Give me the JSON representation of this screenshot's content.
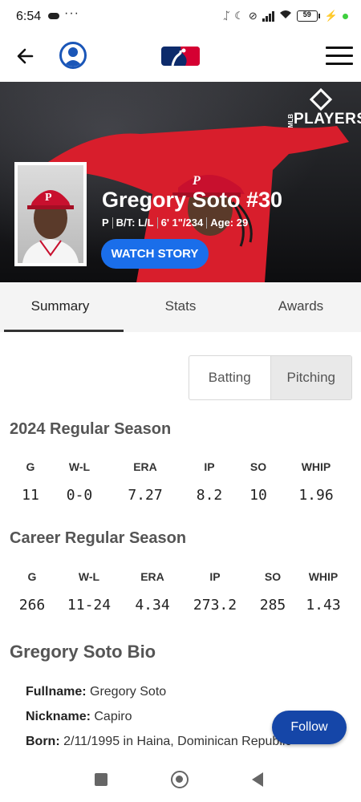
{
  "status_bar": {
    "time": "6:54",
    "battery": "59"
  },
  "header": {
    "logo": "mlb-logo",
    "menu_icon": "hamburger-menu-icon",
    "back_icon": "back-arrow-icon",
    "profile_icon": "user-profile-icon"
  },
  "hero": {
    "badge_text": "PLAYERS",
    "badge_sub": "MLB",
    "name": "Gregory Soto #30",
    "meta": [
      "P",
      "B/T: L/L",
      "6' 1\"/234",
      "Age: 29"
    ],
    "watch_story": "WATCH STORY"
  },
  "tabs": [
    {
      "label": "Summary",
      "active": true
    },
    {
      "label": "Stats",
      "active": false
    },
    {
      "label": "Awards",
      "active": false
    }
  ],
  "segment": {
    "batting": "Batting",
    "pitching": "Pitching",
    "selected": "Pitching"
  },
  "season": {
    "title": "2024 Regular Season",
    "headers": [
      "G",
      "W-L",
      "ERA",
      "IP",
      "SO",
      "WHIP"
    ],
    "values": [
      "11",
      "0-0",
      "7.27",
      "8.2",
      "10",
      "1.96"
    ]
  },
  "career": {
    "title": "Career Regular Season",
    "headers": [
      "G",
      "W-L",
      "ERA",
      "IP",
      "SO",
      "WHIP"
    ],
    "values": [
      "266",
      "11-24",
      "4.34",
      "273.2",
      "285",
      "1.43"
    ]
  },
  "bio": {
    "title": "Gregory Soto Bio",
    "rows": [
      {
        "label": "Fullname:",
        "value": " Gregory Soto"
      },
      {
        "label": "Nickname:",
        "value": " Capiro"
      },
      {
        "label": "Born:",
        "value": " 2/11/1995 in Haina, Dominican Republic"
      }
    ]
  },
  "follow": "Follow",
  "colors": {
    "accent": "#1a6eea",
    "follow": "#1546a8",
    "phillies_red": "#d81e2c",
    "profile_blue": "#1a56b8"
  }
}
